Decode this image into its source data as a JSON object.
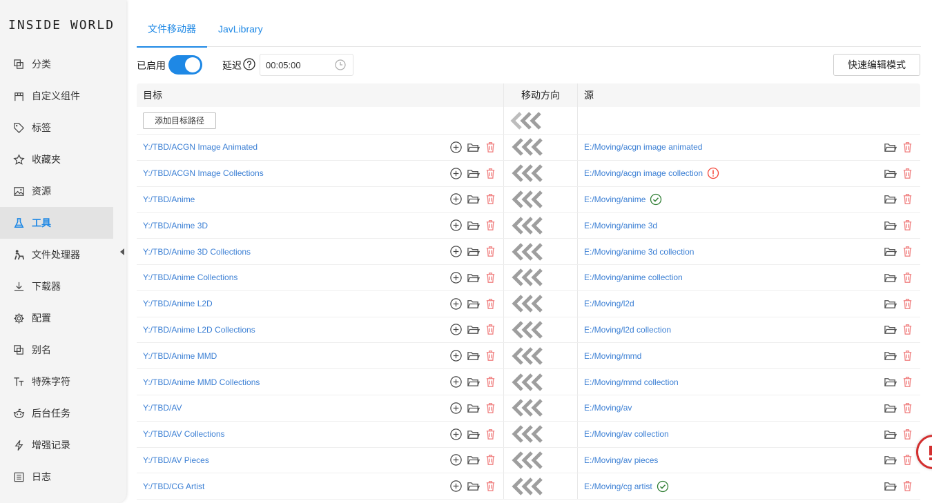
{
  "app": {
    "logo": "INSIDE WORLD"
  },
  "sidebar": {
    "items": [
      {
        "label": "分类",
        "icon": "copy-icon",
        "active": false
      },
      {
        "label": "自定义组件",
        "icon": "component-icon",
        "active": false
      },
      {
        "label": "标签",
        "icon": "tag-icon",
        "active": false
      },
      {
        "label": "收藏夹",
        "icon": "star-icon",
        "active": false
      },
      {
        "label": "资源",
        "icon": "image-icon",
        "active": false
      },
      {
        "label": "工具",
        "icon": "flask-icon",
        "active": true
      },
      {
        "label": "文件处理器",
        "icon": "worker-icon",
        "active": false
      },
      {
        "label": "下载器",
        "icon": "download-icon",
        "active": false
      },
      {
        "label": "配置",
        "icon": "gear-icon",
        "active": false
      },
      {
        "label": "别名",
        "icon": "copy-icon",
        "active": false
      },
      {
        "label": "特殊字符",
        "icon": "text-icon",
        "active": false
      },
      {
        "label": "后台任务",
        "icon": "robot-icon",
        "active": false
      },
      {
        "label": "增强记录",
        "icon": "bolt-icon",
        "active": false
      },
      {
        "label": "日志",
        "icon": "list-icon",
        "active": false
      }
    ]
  },
  "tabs": [
    {
      "label": "文件移动器",
      "active": true
    },
    {
      "label": "JavLibrary",
      "active": false
    }
  ],
  "toolbar": {
    "enabled_label": "已启用",
    "enabled": true,
    "delay_label": "延迟",
    "delay_value": "00:05:00",
    "quick_edit_label": "快速编辑模式"
  },
  "table": {
    "headers": {
      "target": "目标",
      "direction": "移动方向",
      "source": "源"
    },
    "add_target_label": "添加目标路径",
    "rows": [
      {
        "target": "Y:/TBD/ACGN Image Animated",
        "source": "E:/Moving/acgn image animated",
        "status": ""
      },
      {
        "target": "Y:/TBD/ACGN Image Collections",
        "source": "E:/Moving/acgn image collection",
        "status": "warning"
      },
      {
        "target": "Y:/TBD/Anime",
        "source": "E:/Moving/anime",
        "status": "ok"
      },
      {
        "target": "Y:/TBD/Anime 3D",
        "source": "E:/Moving/anime 3d",
        "status": ""
      },
      {
        "target": "Y:/TBD/Anime 3D Collections",
        "source": "E:/Moving/anime 3d collection",
        "status": ""
      },
      {
        "target": "Y:/TBD/Anime Collections",
        "source": "E:/Moving/anime collection",
        "status": ""
      },
      {
        "target": "Y:/TBD/Anime L2D",
        "source": "E:/Moving/l2d",
        "status": ""
      },
      {
        "target": "Y:/TBD/Anime L2D Collections",
        "source": "E:/Moving/l2d collection",
        "status": ""
      },
      {
        "target": "Y:/TBD/Anime MMD",
        "source": "E:/Moving/mmd",
        "status": ""
      },
      {
        "target": "Y:/TBD/Anime MMD Collections",
        "source": "E:/Moving/mmd collection",
        "status": ""
      },
      {
        "target": "Y:/TBD/AV",
        "source": "E:/Moving/av",
        "status": ""
      },
      {
        "target": "Y:/TBD/AV Collections",
        "source": "E:/Moving/av collection",
        "status": ""
      },
      {
        "target": "Y:/TBD/AV Pieces",
        "source": "E:/Moving/av pieces",
        "status": ""
      },
      {
        "target": "Y:/TBD/CG Artist",
        "source": "E:/Moving/cg artist",
        "status": "ok"
      }
    ]
  },
  "colors": {
    "accent": "#1e88e5",
    "link": "#3b7fd4",
    "delete": "#f08080",
    "warning": "#f44336",
    "ok": "#2e7d32",
    "arrow": "#9e9e9e"
  }
}
